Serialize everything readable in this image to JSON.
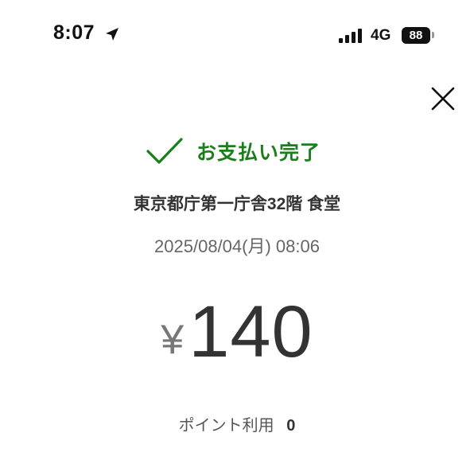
{
  "status_bar": {
    "time": "8:07",
    "network": "4G",
    "battery_level": "88",
    "icons": [
      "location-arrow-icon",
      "signal-bars-icon",
      "battery-icon"
    ]
  },
  "header": {
    "close_icon": "close-icon"
  },
  "payment": {
    "status_label": "お支払い完了",
    "status_icon": "checkmark-icon",
    "status_color": "#1a7f1a",
    "store_name": "東京都庁第一庁舎32階 食堂",
    "datetime": "2025/08/04(月) 08:06",
    "currency_symbol": "¥",
    "amount": "140",
    "points_label": "ポイント利用",
    "points_value": "0"
  }
}
